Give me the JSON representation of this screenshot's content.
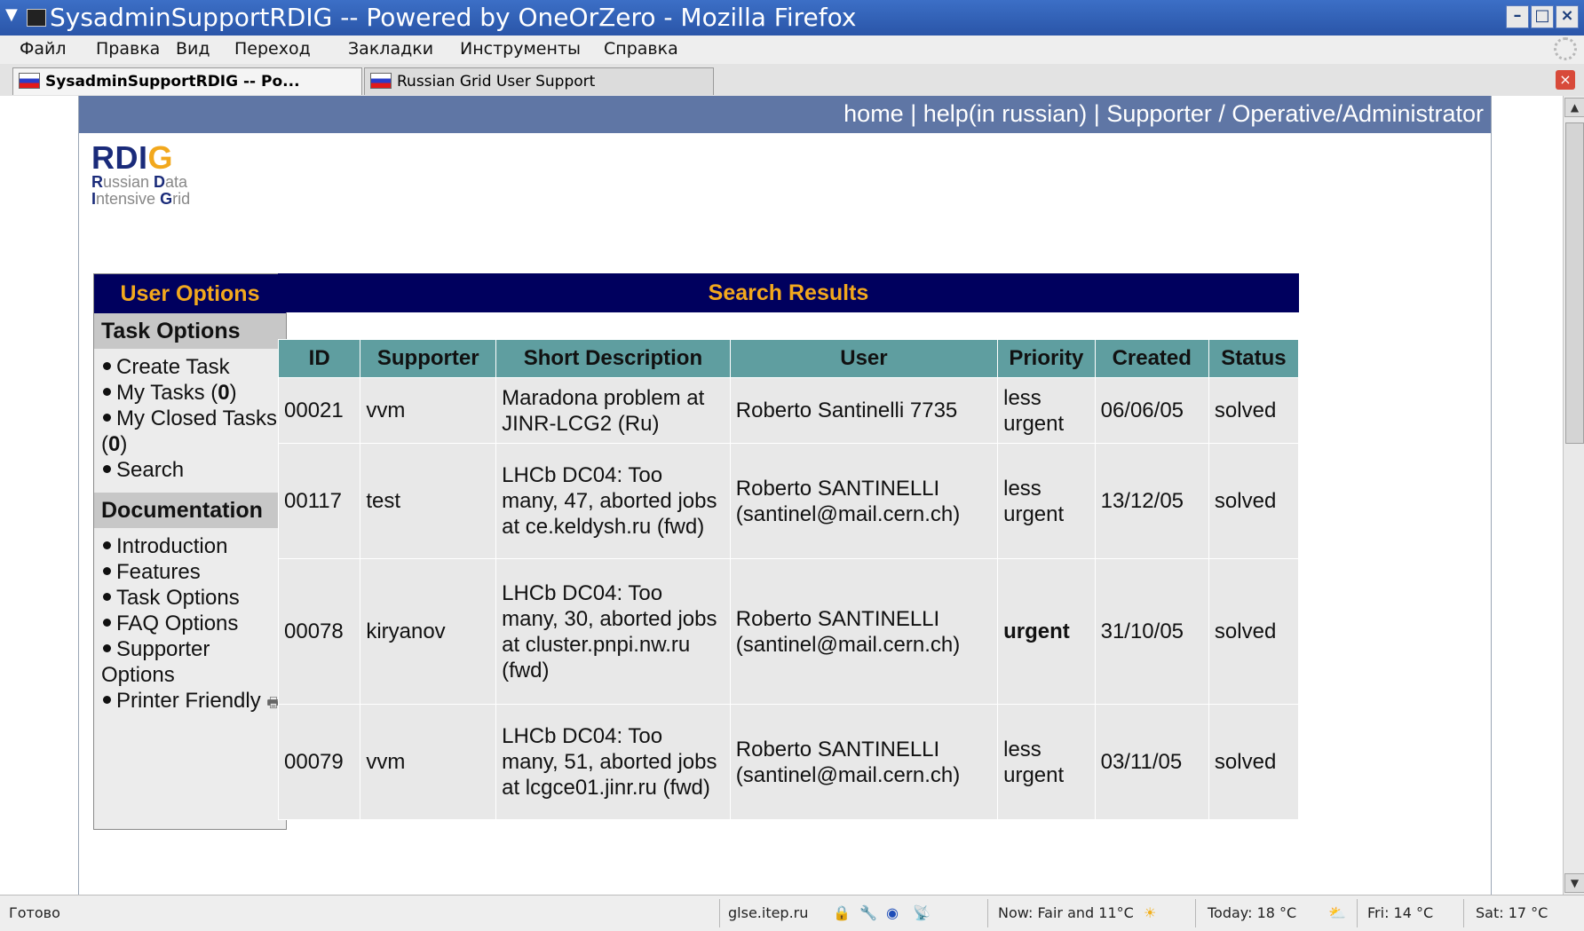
{
  "window": {
    "title": "SysadminSupportRDIG -- Powered by OneOrZero - Mozilla Firefox"
  },
  "menubar": [
    "Файл",
    "Правка",
    "Вид",
    "Переход",
    "Закладки",
    "Инструменты",
    "Справка"
  ],
  "tabs": [
    {
      "label": "SysadminSupportRDIG -- Po...",
      "active": true
    },
    {
      "label": "Russian Grid User Support",
      "active": false
    }
  ],
  "topnav": {
    "links": "home | help(in russian) | Supporter / Operative/Administrator"
  },
  "logo": {
    "letters": "RDI",
    "accent_letter": "G",
    "line1_a": "R",
    "line1_b": "ussian ",
    "line1_c": "D",
    "line1_d": "ata",
    "line2_a": "I",
    "line2_b": "ntensive ",
    "line2_c": "G",
    "line2_d": "rid"
  },
  "sidebar": {
    "title": "User Options",
    "task_options": {
      "heading": "Task Options",
      "items": [
        {
          "label": "Create Task"
        },
        {
          "label": "My Tasks (",
          "count": "0",
          "suffix": ")"
        },
        {
          "label": "My Closed Tasks (",
          "count": "0",
          "suffix": ")"
        },
        {
          "label": "Search"
        }
      ]
    },
    "documentation": {
      "heading": "Documentation",
      "items": [
        "Introduction",
        "Features",
        "Task Options",
        "FAQ Options",
        "Supporter Options",
        "Printer Friendly"
      ]
    }
  },
  "results": {
    "title": "Search Results",
    "columns": [
      "ID",
      "Supporter",
      "Short Description",
      "User",
      "Priority",
      "Created",
      "Status"
    ],
    "rows": [
      {
        "id": "00021",
        "supporter": "vvm",
        "desc": "Maradona problem at JINR-LCG2 (Ru)",
        "user": "Roberto Santinelli 7735",
        "priority": "less urgent",
        "created": "06/06/05",
        "status": "solved"
      },
      {
        "id": "00117",
        "supporter": "test",
        "desc": "LHCb DC04: Too many, 47, aborted jobs at ce.keldysh.ru (fwd)",
        "user": "Roberto SANTINELLI (santinel@mail.cern.ch)",
        "priority": "less urgent",
        "created": "13/12/05",
        "status": "solved"
      },
      {
        "id": "00078",
        "supporter": "kiryanov",
        "desc": "LHCb DC04: Too many, 30, aborted jobs at cluster.pnpi.nw.ru (fwd)",
        "user": "Roberto SANTINELLI (santinel@mail.cern.ch)",
        "priority": "urgent",
        "created": "31/10/05",
        "status": "solved"
      },
      {
        "id": "00079",
        "supporter": "vvm",
        "desc": "LHCb DC04: Too many, 51, aborted jobs at lcgce01.jinr.ru (fwd)",
        "user": "Roberto SANTINELLI (santinel@mail.cern.ch)",
        "priority": "less urgent",
        "created": "03/11/05",
        "status": "solved"
      }
    ]
  },
  "statusbar": {
    "status": "Готово",
    "host": "glse.itep.ru",
    "weather_now": "Now: Fair and 11°C",
    "weather_today": "Today: 18 °C",
    "weather_fri": "Fri: 14 °C",
    "weather_sat": "Sat: 17 °C"
  },
  "colors": {
    "nav_bar": "#5f76a5",
    "panel_header": "#00005e",
    "panel_header_text": "#f2a81d",
    "table_header": "#5f9ea0",
    "cell_bg": "#e8e8e8"
  }
}
